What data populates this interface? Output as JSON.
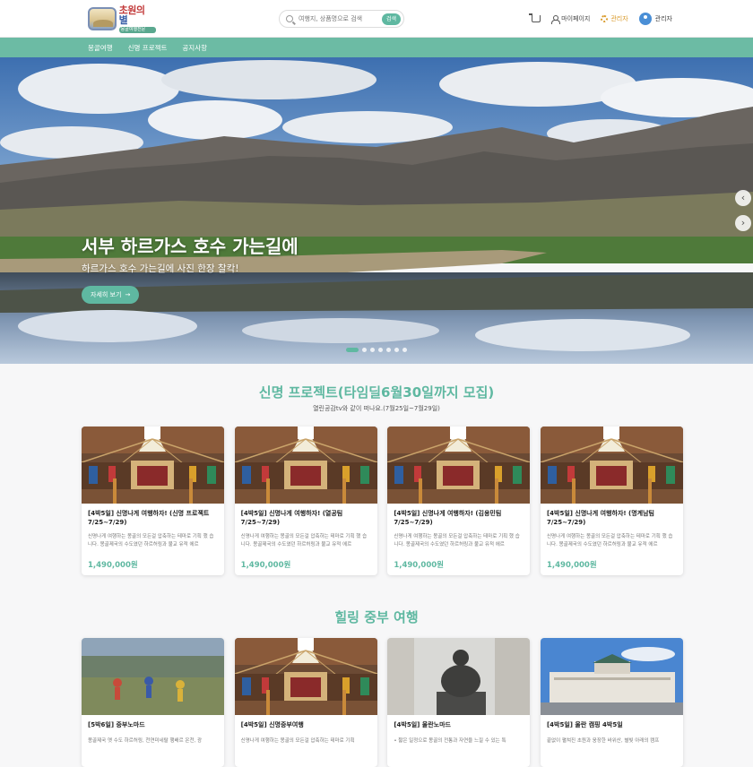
{
  "header": {
    "logo_text_main": "초원의 ",
    "logo_text_accent": "별",
    "logo_text_sub": "몽골여행전문",
    "search_placeholder": "여행지, 상품명으로 검색",
    "search_button": "검색",
    "mypage": "마이페이지",
    "admin": "관리자",
    "user_name": "관리자"
  },
  "nav": {
    "items": [
      "몽골여행",
      "신명 프로젝트",
      "공지사항"
    ]
  },
  "hero": {
    "title": "서부 하르가스 호수 가는길에",
    "subtitle": "하르가스 호수 가는길에 사진 한장 찰칵!",
    "button": "자세히 보기",
    "arrow_prev": "‹",
    "arrow_next": "›",
    "slide_count": 7,
    "active_slide": 1
  },
  "section1": {
    "title": "신명 프로젝트(타임딜6월30일까지 모집)",
    "subtitle": "열린공감tv와 같이 떠나요.(7월25일~7월29일)",
    "cards": [
      {
        "title": "[4박5일] 신명나게 여행하자! (신명 프로젝트 7/25~7/29)",
        "desc": "신명나게 여행하는 몽골의 모든걸 압축하는 테마로 기획 했 습니다. 몽골제국의 수도였던 하르허링과 불교 유적 에르",
        "price": "1,490,000원"
      },
      {
        "title": "[4박5일] 신명나게 여행하자! (열공팀 7/25~7/29)",
        "desc": "신명나게 여행하는 몽골의 모든걸 압축하는 테마로 기획 했 습니다. 몽골제국의 수도였던 하르허링과 불교 유적 에르",
        "price": "1,490,000원"
      },
      {
        "title": "[4박5일] 신명나게 여행하자! (김용민팀 7/25~7/29)",
        "desc": "신명나게 여행하는 몽골의 모든걸 압축하는 테마로 기획 했 습니다. 몽골제국의 수도였던 하르허링과 불교 유적 에르",
        "price": "1,490,000원"
      },
      {
        "title": "[4박5일] 신명나게 여행하자! (명계남팀 7/25~7/29)",
        "desc": "신명나게 여행하는 몽골의 모든걸 압축하는 테마로 기획 했 습니다. 몽골제국의 수도였던 하르허링과 불교 유적 에르",
        "price": "1,490,000원"
      }
    ]
  },
  "section2": {
    "title": "힐링 중부 여행",
    "cards": [
      {
        "title": "[5박6일] 중부노마드",
        "desc": "몽골제국 옛 수도 하르허링, 천연미네랄 행배르 온천, 광"
      },
      {
        "title": "[4박5일] 신명중부여행",
        "desc": "신명나게 여행하는 몽골의 모든걸 압축하는 테마로 기획"
      },
      {
        "title": "[4박5일] 울란노마드",
        "desc": "• 짧은 일정으로 몽골의 전통과 자연을 느낄 수 있는 특"
      },
      {
        "title": "[4박5일] 울란 캠핑 4박5일",
        "desc": "끝없이 펼쳐진 초원과 웅장한 바위산, 별빛 아래의 캠프"
      }
    ]
  },
  "colors": {
    "accent": "#5fb8a1",
    "nav_bg": "#6cbba4",
    "admin": "#d99a2b"
  }
}
